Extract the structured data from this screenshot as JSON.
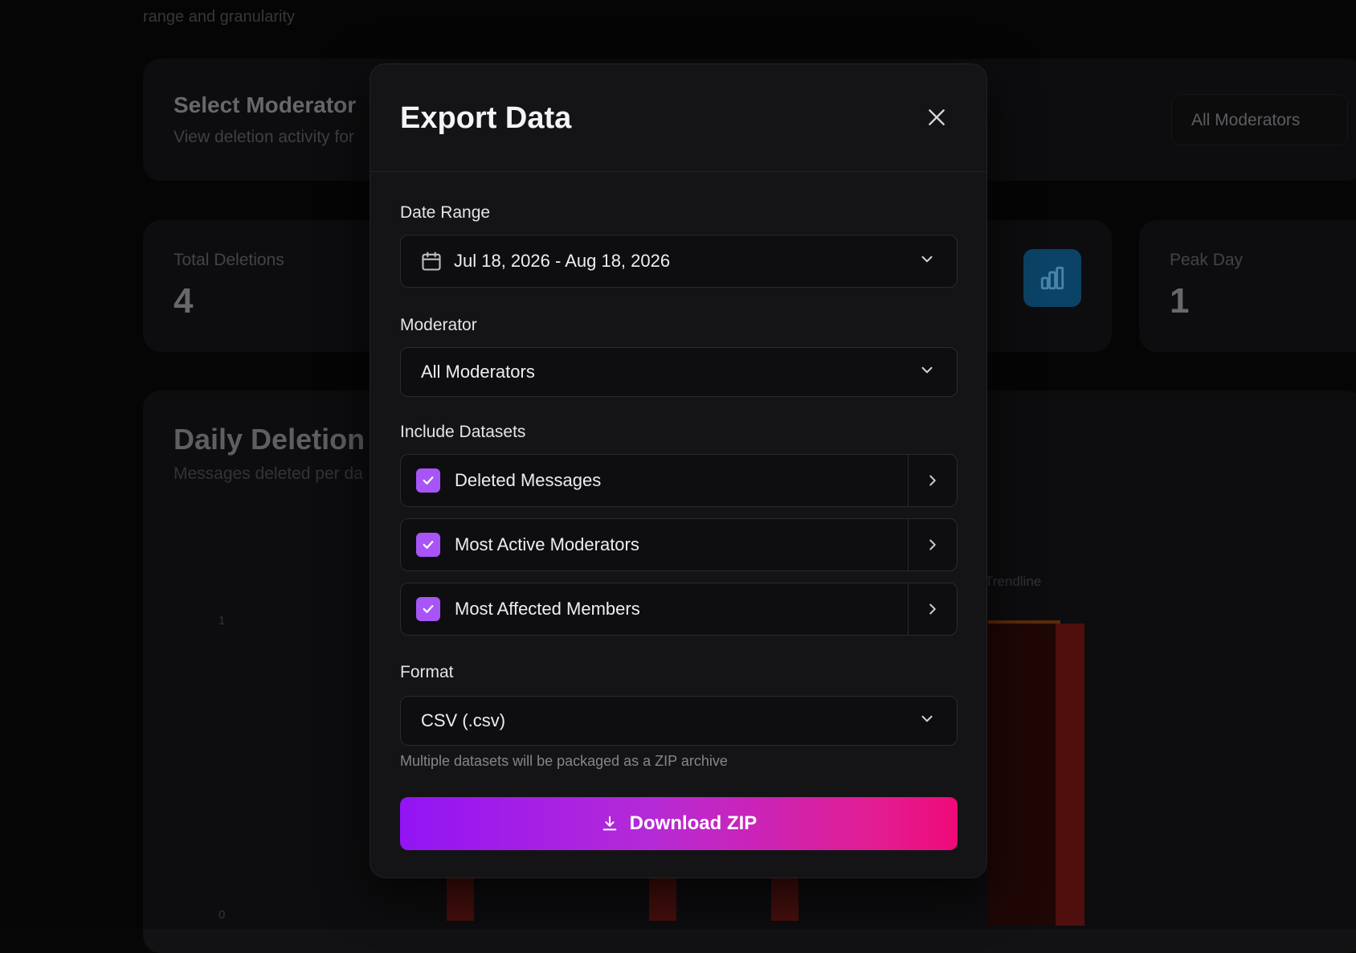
{
  "background": {
    "subtitle": "range and granularity",
    "moderator_card": {
      "title": "Select Moderator",
      "subtitle": "View deletion activity for",
      "select_value": "All Moderators"
    },
    "stats": [
      {
        "label": "Total Deletions",
        "value": "4"
      },
      {
        "label": "Peak Day",
        "value": "1"
      }
    ],
    "chart": {
      "title": "Daily Deletion",
      "subtitle": "Messages deleted per da",
      "legend_trendline": "Trendline",
      "y_ticks": [
        "1",
        "0"
      ]
    }
  },
  "modal": {
    "title": "Export Data",
    "date_range": {
      "label": "Date Range",
      "value": "Jul 18, 2026 - Aug 18, 2026"
    },
    "moderator": {
      "label": "Moderator",
      "value": "All Moderators"
    },
    "datasets": {
      "label": "Include Datasets",
      "items": [
        {
          "name": "Deleted Messages",
          "checked": true
        },
        {
          "name": "Most Active Moderators",
          "checked": true
        },
        {
          "name": "Most Affected Members",
          "checked": true
        }
      ]
    },
    "format": {
      "label": "Format",
      "value": "CSV (.csv)",
      "hint": "Multiple datasets will be packaged as a ZIP archive"
    },
    "download_label": "Download ZIP"
  },
  "colors": {
    "checkbox": "#a855f7",
    "button_gradient_start": "#9314f5",
    "button_gradient_end": "#ef0a78",
    "stat_icon_tile": "#0f5a88"
  }
}
